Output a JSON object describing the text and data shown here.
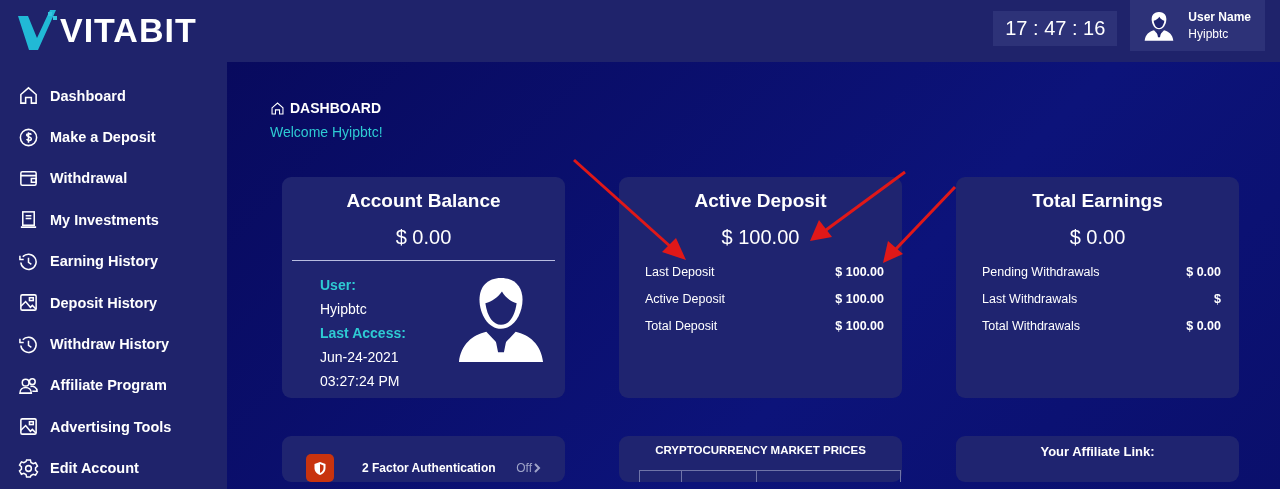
{
  "header": {
    "logo": "VITABIT",
    "clock": "17 : 47 : 16",
    "user_label": "User Name",
    "user_name": "Hyipbtc"
  },
  "sidebar": {
    "items": [
      {
        "label": "Dashboard"
      },
      {
        "label": "Make a Deposit"
      },
      {
        "label": "Withdrawal"
      },
      {
        "label": "My Investments"
      },
      {
        "label": "Earning History"
      },
      {
        "label": "Deposit History"
      },
      {
        "label": "Withdraw History"
      },
      {
        "label": "Affiliate Program"
      },
      {
        "label": "Advertising Tools"
      },
      {
        "label": "Edit Account"
      }
    ]
  },
  "breadcrumb": "DASHBOARD",
  "welcome": "Welcome Hyipbtc!",
  "cards": [
    {
      "kind": "balance",
      "title": "Account Balance",
      "amount": "$ 0.00",
      "info": [
        {
          "kind": "label",
          "text": "User:"
        },
        {
          "kind": "value",
          "text": "Hyipbtc"
        },
        {
          "kind": "label",
          "text": "Last Access:"
        },
        {
          "kind": "value",
          "text": "Jun-24-2021"
        },
        {
          "kind": "value",
          "text": "03:27:24 PM"
        }
      ]
    },
    {
      "kind": "stats",
      "title": "Active Deposit",
      "amount": "$ 100.00",
      "rows": [
        {
          "label": "Last Deposit",
          "value": "$ 100.00"
        },
        {
          "label": "Active Deposit",
          "value": "$ 100.00"
        },
        {
          "label": "Total Deposit",
          "value": "$ 100.00"
        }
      ]
    },
    {
      "kind": "stats",
      "title": "Total Earnings",
      "amount": "$ 0.00",
      "rows": [
        {
          "label": "Pending Withdrawals",
          "value": "$ 0.00"
        },
        {
          "label": "Last Withdrawals",
          "value": "$"
        },
        {
          "label": "Total Withdrawals",
          "value": "$ 0.00"
        }
      ]
    }
  ],
  "panels": [
    {
      "kind": "security",
      "label": "2 Factor Authentication",
      "status": "Off"
    },
    {
      "kind": "market",
      "title": "CRYPTOCURRENCY MARKET PRICES"
    },
    {
      "kind": "affiliate",
      "title": "Your Affiliate Link:"
    }
  ]
}
